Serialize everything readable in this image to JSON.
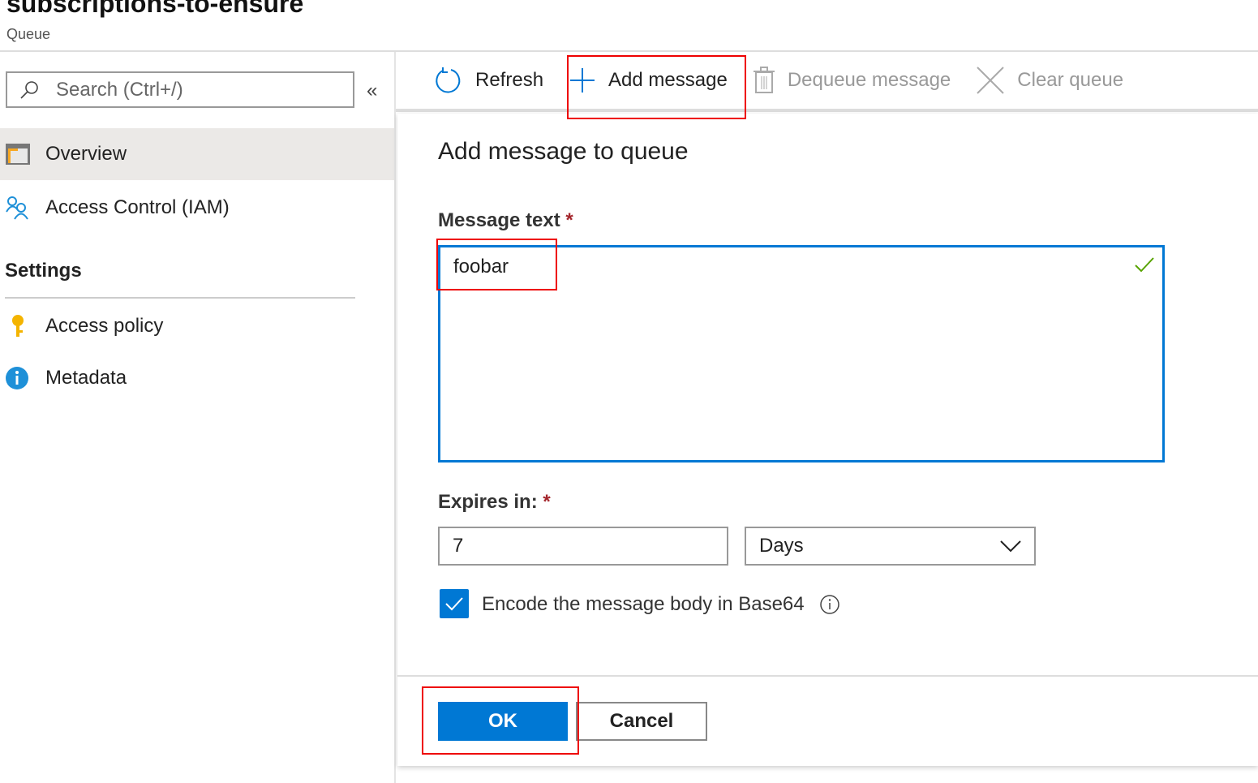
{
  "header": {
    "title": "subscriptions-to-ensure",
    "subtitle": "Queue"
  },
  "sidebar": {
    "search_placeholder": "Search (Ctrl+/)",
    "collapse": "«",
    "items": [
      {
        "label": "Overview"
      },
      {
        "label": "Access Control (IAM)"
      }
    ],
    "section": "Settings",
    "settings_items": [
      {
        "label": "Access policy"
      },
      {
        "label": "Metadata"
      }
    ]
  },
  "toolbar": {
    "refresh": "Refresh",
    "add": "Add message",
    "dequeue": "Dequeue message",
    "clear": "Clear queue"
  },
  "form": {
    "title": "Add message to queue",
    "message_label": "Message text",
    "required": "*",
    "message_value": "foobar",
    "expires_label": "Expires in:",
    "expires_value": "7",
    "unit": "Days",
    "encode_label": "Encode the message body in Base64",
    "encode_checked": true,
    "ok": "OK",
    "cancel": "Cancel"
  },
  "colors": {
    "accent": "#0078d4",
    "highlight": "#e00000"
  }
}
